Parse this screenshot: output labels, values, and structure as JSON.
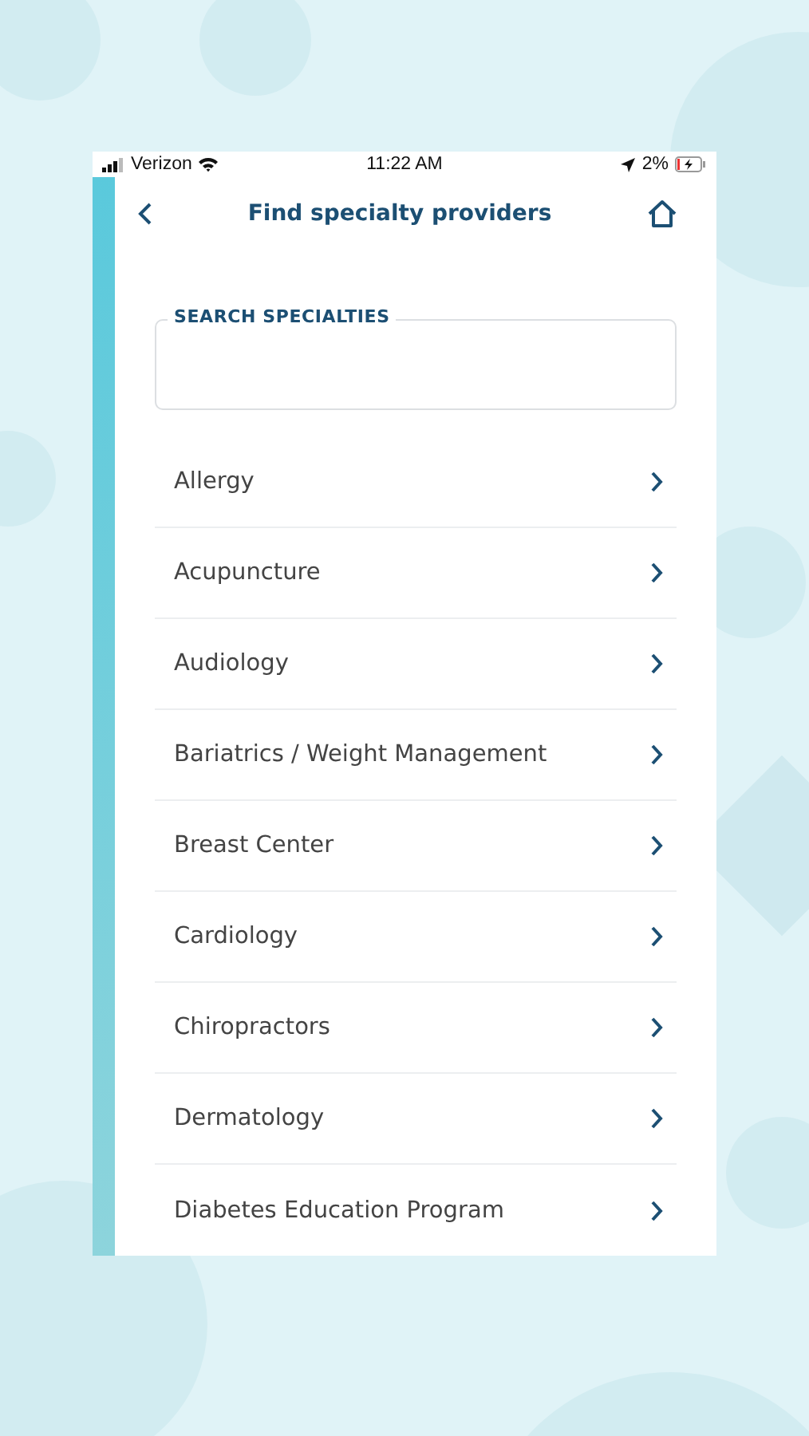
{
  "status_bar": {
    "carrier": "Verizon",
    "time": "11:22 AM",
    "battery": "2%"
  },
  "header": {
    "title": "Find specialty providers"
  },
  "search": {
    "label": "SEARCH SPECIALTIES"
  },
  "specialties": [
    {
      "label": "Allergy"
    },
    {
      "label": "Acupuncture"
    },
    {
      "label": "Audiology"
    },
    {
      "label": "Bariatrics / Weight Management"
    },
    {
      "label": "Breast Center"
    },
    {
      "label": "Cardiology"
    },
    {
      "label": "Chiropractors"
    },
    {
      "label": "Dermatology"
    },
    {
      "label": "Diabetes Education Program"
    }
  ]
}
